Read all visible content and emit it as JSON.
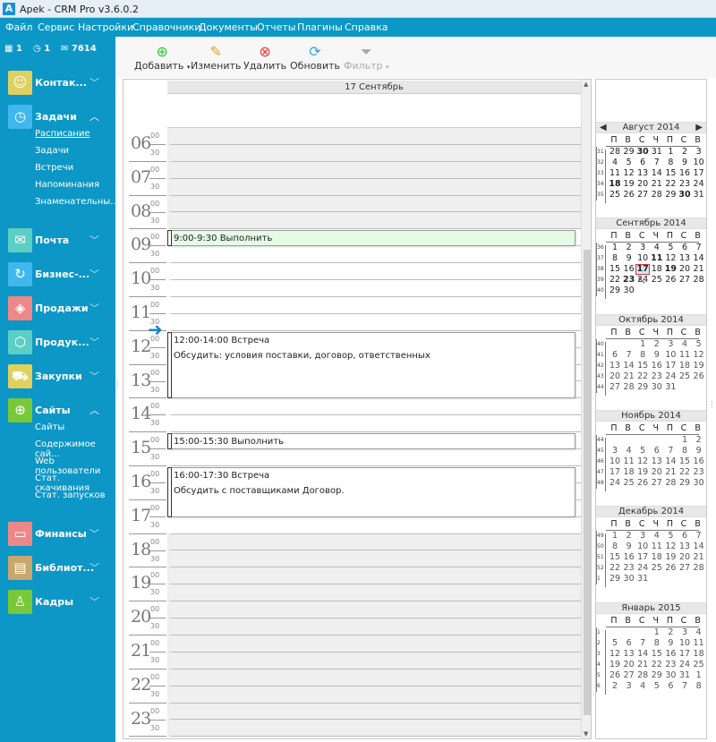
{
  "window": {
    "title": "Apek - CRM Pro v3.6.0.2",
    "logo": "A"
  },
  "menu": [
    "Файл",
    "Сервис",
    "Настройки",
    "Справочники",
    "Документы",
    "Отчеты",
    "Плагины",
    "Справка"
  ],
  "counters": {
    "calendar": "1",
    "clock": "1",
    "mail": "7614"
  },
  "sidebar": {
    "items": [
      {
        "label": "Контак...",
        "icon": "contacts-icon",
        "color": "#e0d060",
        "expanded": false
      },
      {
        "label": "Задачи",
        "icon": "clock-icon",
        "color": "#40b8ee",
        "expanded": true,
        "sub": [
          "Расписание",
          "Задачи",
          "Встречи",
          "Напоминания",
          "Знаменательны..."
        ]
      },
      {
        "label": "Почта",
        "icon": "mail-icon",
        "color": "#5ccfc5",
        "expanded": false
      },
      {
        "label": "Бизнес-...",
        "icon": "cycle-icon",
        "color": "#40b8ee",
        "expanded": false
      },
      {
        "label": "Продажи",
        "icon": "tag-icon",
        "color": "#ee8888",
        "expanded": false
      },
      {
        "label": "Продук...",
        "icon": "box-icon",
        "color": "#5ccfc5",
        "expanded": false
      },
      {
        "label": "Закупки",
        "icon": "cart-icon",
        "color": "#e0d060",
        "expanded": false
      },
      {
        "label": "Сайты",
        "icon": "globe-icon",
        "color": "#78c83a",
        "expanded": true,
        "sub": [
          "Сайты",
          "Содержимое сай...",
          "Web пользователи",
          "Стат. скачивания",
          "Стат. запусков"
        ]
      },
      {
        "label": "Финансы",
        "icon": "wallet-icon",
        "color": "#ee8888",
        "expanded": false
      },
      {
        "label": "Библиот...",
        "icon": "book-icon",
        "color": "#c9a66b",
        "expanded": false
      },
      {
        "label": "Кадры",
        "icon": "person-icon",
        "color": "#78c83a",
        "expanded": false
      }
    ]
  },
  "toolbar": {
    "add": "Добавить",
    "edit": "Изменить",
    "delete": "Удалить",
    "refresh": "Обновить",
    "filter": "Фильтр"
  },
  "schedule": {
    "day_header": "17 Сентябрь",
    "hours": [
      "06",
      "07",
      "08",
      "09",
      "10",
      "11",
      "12",
      "13",
      "14",
      "15",
      "16",
      "17",
      "18",
      "19",
      "20",
      "21",
      "22",
      "23"
    ],
    "minutes": [
      "00",
      "30"
    ],
    "events": [
      {
        "start": 9,
        "end": 9.5,
        "title": "9:00-9:30 Выполнить",
        "body": "",
        "color": "#e6fbe6"
      },
      {
        "start": 12,
        "end": 14,
        "title": "12:00-14:00 Встреча",
        "body": "Обсудить: условия поставки, договор, ответственных",
        "color": "#ffffff"
      },
      {
        "start": 15,
        "end": 15.5,
        "title": "15:00-15:30 Выполнить",
        "body": "",
        "color": "#ffffff"
      },
      {
        "start": 16,
        "end": 17.5,
        "title": "16:00-17:30 Встреча",
        "body": "Обсудить с поставщиками Договор.",
        "color": "#ffffff"
      }
    ],
    "work_start": 9,
    "work_end": 18,
    "current_time": 12
  },
  "calendar": {
    "dow": [
      "П",
      "В",
      "С",
      "Ч",
      "П",
      "С",
      "В"
    ],
    "months": [
      {
        "title": "Август 2014",
        "nav": true,
        "bold": [
          "30",
          "18"
        ],
        "weeks": [
          [
            "31",
            "28",
            "29",
            "30",
            "31",
            "1",
            "2",
            "3"
          ],
          [
            "32",
            "4",
            "5",
            "6",
            "7",
            "8",
            "9",
            "10"
          ],
          [
            "33",
            "11",
            "12",
            "13",
            "14",
            "15",
            "16",
            "17"
          ],
          [
            "34",
            "18",
            "19",
            "20",
            "21",
            "22",
            "23",
            "24"
          ],
          [
            "35",
            "25",
            "26",
            "27",
            "28",
            "29",
            "30",
            "31"
          ]
        ]
      },
      {
        "title": "Сентябрь 2014",
        "bold": [
          "11",
          "17",
          "19",
          "23"
        ],
        "selected": "17",
        "weeks": [
          [
            "36",
            "1",
            "2",
            "3",
            "4",
            "5",
            "6",
            "7"
          ],
          [
            "37",
            "8",
            "9",
            "10",
            "11",
            "12",
            "13",
            "14"
          ],
          [
            "38",
            "15",
            "16",
            "17",
            "18",
            "19",
            "20",
            "21"
          ],
          [
            "39",
            "22",
            "23",
            "24",
            "25",
            "26",
            "27",
            "28"
          ],
          [
            "40",
            "29",
            "30",
            "",
            "",
            "",
            "",
            ""
          ]
        ]
      },
      {
        "title": "Октябрь 2014",
        "weeks": [
          [
            "40",
            "",
            "",
            "1",
            "2",
            "3",
            "4",
            "5"
          ],
          [
            "41",
            "6",
            "7",
            "8",
            "9",
            "10",
            "11",
            "12"
          ],
          [
            "42",
            "13",
            "14",
            "15",
            "16",
            "17",
            "18",
            "19"
          ],
          [
            "43",
            "20",
            "21",
            "22",
            "23",
            "24",
            "25",
            "26"
          ],
          [
            "44",
            "27",
            "28",
            "29",
            "30",
            "31",
            "",
            ""
          ]
        ]
      },
      {
        "title": "Ноябрь 2014",
        "weeks": [
          [
            "44",
            "",
            "",
            "",
            "",
            "",
            "1",
            "2"
          ],
          [
            "45",
            "3",
            "4",
            "5",
            "6",
            "7",
            "8",
            "9"
          ],
          [
            "46",
            "10",
            "11",
            "12",
            "13",
            "14",
            "15",
            "16"
          ],
          [
            "47",
            "17",
            "18",
            "19",
            "20",
            "21",
            "22",
            "23"
          ],
          [
            "48",
            "24",
            "25",
            "26",
            "27",
            "28",
            "29",
            "30"
          ]
        ]
      },
      {
        "title": "Декабрь 2014",
        "weeks": [
          [
            "49",
            "1",
            "2",
            "3",
            "4",
            "5",
            "6",
            "7"
          ],
          [
            "50",
            "8",
            "9",
            "10",
            "11",
            "12",
            "13",
            "14"
          ],
          [
            "51",
            "15",
            "16",
            "17",
            "18",
            "19",
            "20",
            "21"
          ],
          [
            "52",
            "22",
            "23",
            "24",
            "25",
            "26",
            "27",
            "28"
          ],
          [
            "1",
            "29",
            "30",
            "31",
            "",
            "",
            "",
            ""
          ]
        ]
      },
      {
        "title": "Январь 2015",
        "weeks": [
          [
            "1",
            "",
            "",
            "",
            "1",
            "2",
            "3",
            "4"
          ],
          [
            "2",
            "5",
            "6",
            "7",
            "8",
            "9",
            "10",
            "11"
          ],
          [
            "3",
            "12",
            "13",
            "14",
            "15",
            "16",
            "17",
            "18"
          ],
          [
            "4",
            "19",
            "20",
            "21",
            "22",
            "23",
            "24",
            "25"
          ],
          [
            "5",
            "26",
            "27",
            "28",
            "29",
            "30",
            "31",
            "1"
          ],
          [
            "6",
            "2",
            "3",
            "4",
            "5",
            "6",
            "7",
            "8"
          ]
        ]
      }
    ]
  }
}
